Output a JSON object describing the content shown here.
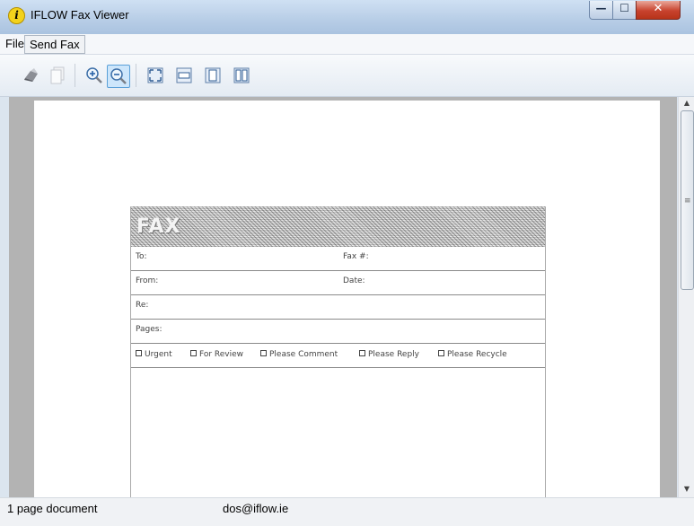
{
  "window": {
    "title": "IFLOW Fax Viewer",
    "app_icon_glyph": "i",
    "controls": {
      "minimize": "—",
      "maximize": "☐",
      "close": "✕"
    }
  },
  "menu": {
    "items": [
      {
        "label": "File"
      },
      {
        "label": "Send Fax"
      }
    ]
  },
  "toolbar": {
    "buttons": [
      {
        "icon": "print-icon"
      },
      {
        "icon": "copy-icon"
      },
      {
        "icon": "zoom-in-icon"
      },
      {
        "icon": "zoom-out-icon",
        "selected": true
      },
      {
        "icon": "fit-page-icon"
      },
      {
        "icon": "fit-width-icon"
      },
      {
        "icon": "single-page-icon"
      },
      {
        "icon": "two-page-icon"
      }
    ]
  },
  "fax_form": {
    "banner": "FAX",
    "fields": {
      "to": "To:",
      "fax_number": "Fax #:",
      "from": "From:",
      "date": "Date:",
      "re": "Re:",
      "pages": "Pages:"
    },
    "checkboxes": [
      "Urgent",
      "For Review",
      "Please Comment",
      "Please Reply",
      "Please Recycle"
    ]
  },
  "status": {
    "page_count": "1 page document",
    "user": "dos@iflow.ie"
  },
  "colors": {
    "accent_selected": "#cde6fb",
    "close_button": "#c8432e",
    "viewer_background": "#b3b3b3"
  }
}
